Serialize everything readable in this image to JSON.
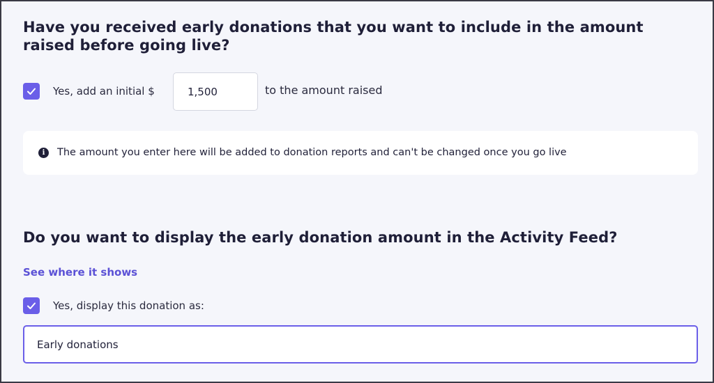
{
  "early_donations": {
    "question": "Have you received early donations that you want to include in the amount raised before going live?",
    "checkbox_checked": true,
    "label_before": "Yes, add an initial $",
    "amount_value": "1,500",
    "label_after": "to the amount raised",
    "info_icon": "info-icon",
    "info_text": "The amount you enter here will be added to donation reports and can't be changed once you go live"
  },
  "activity_feed": {
    "question": "Do you want to display the early donation amount in the Activity Feed?",
    "link_text": "See where it shows",
    "checkbox_checked": true,
    "checkbox_label": "Yes, display this donation as:",
    "display_value": "Early donations"
  },
  "colors": {
    "accent": "#6a5ee8",
    "link": "#5b51d6",
    "heading": "#1f1f38",
    "background": "#f5f6fb"
  }
}
